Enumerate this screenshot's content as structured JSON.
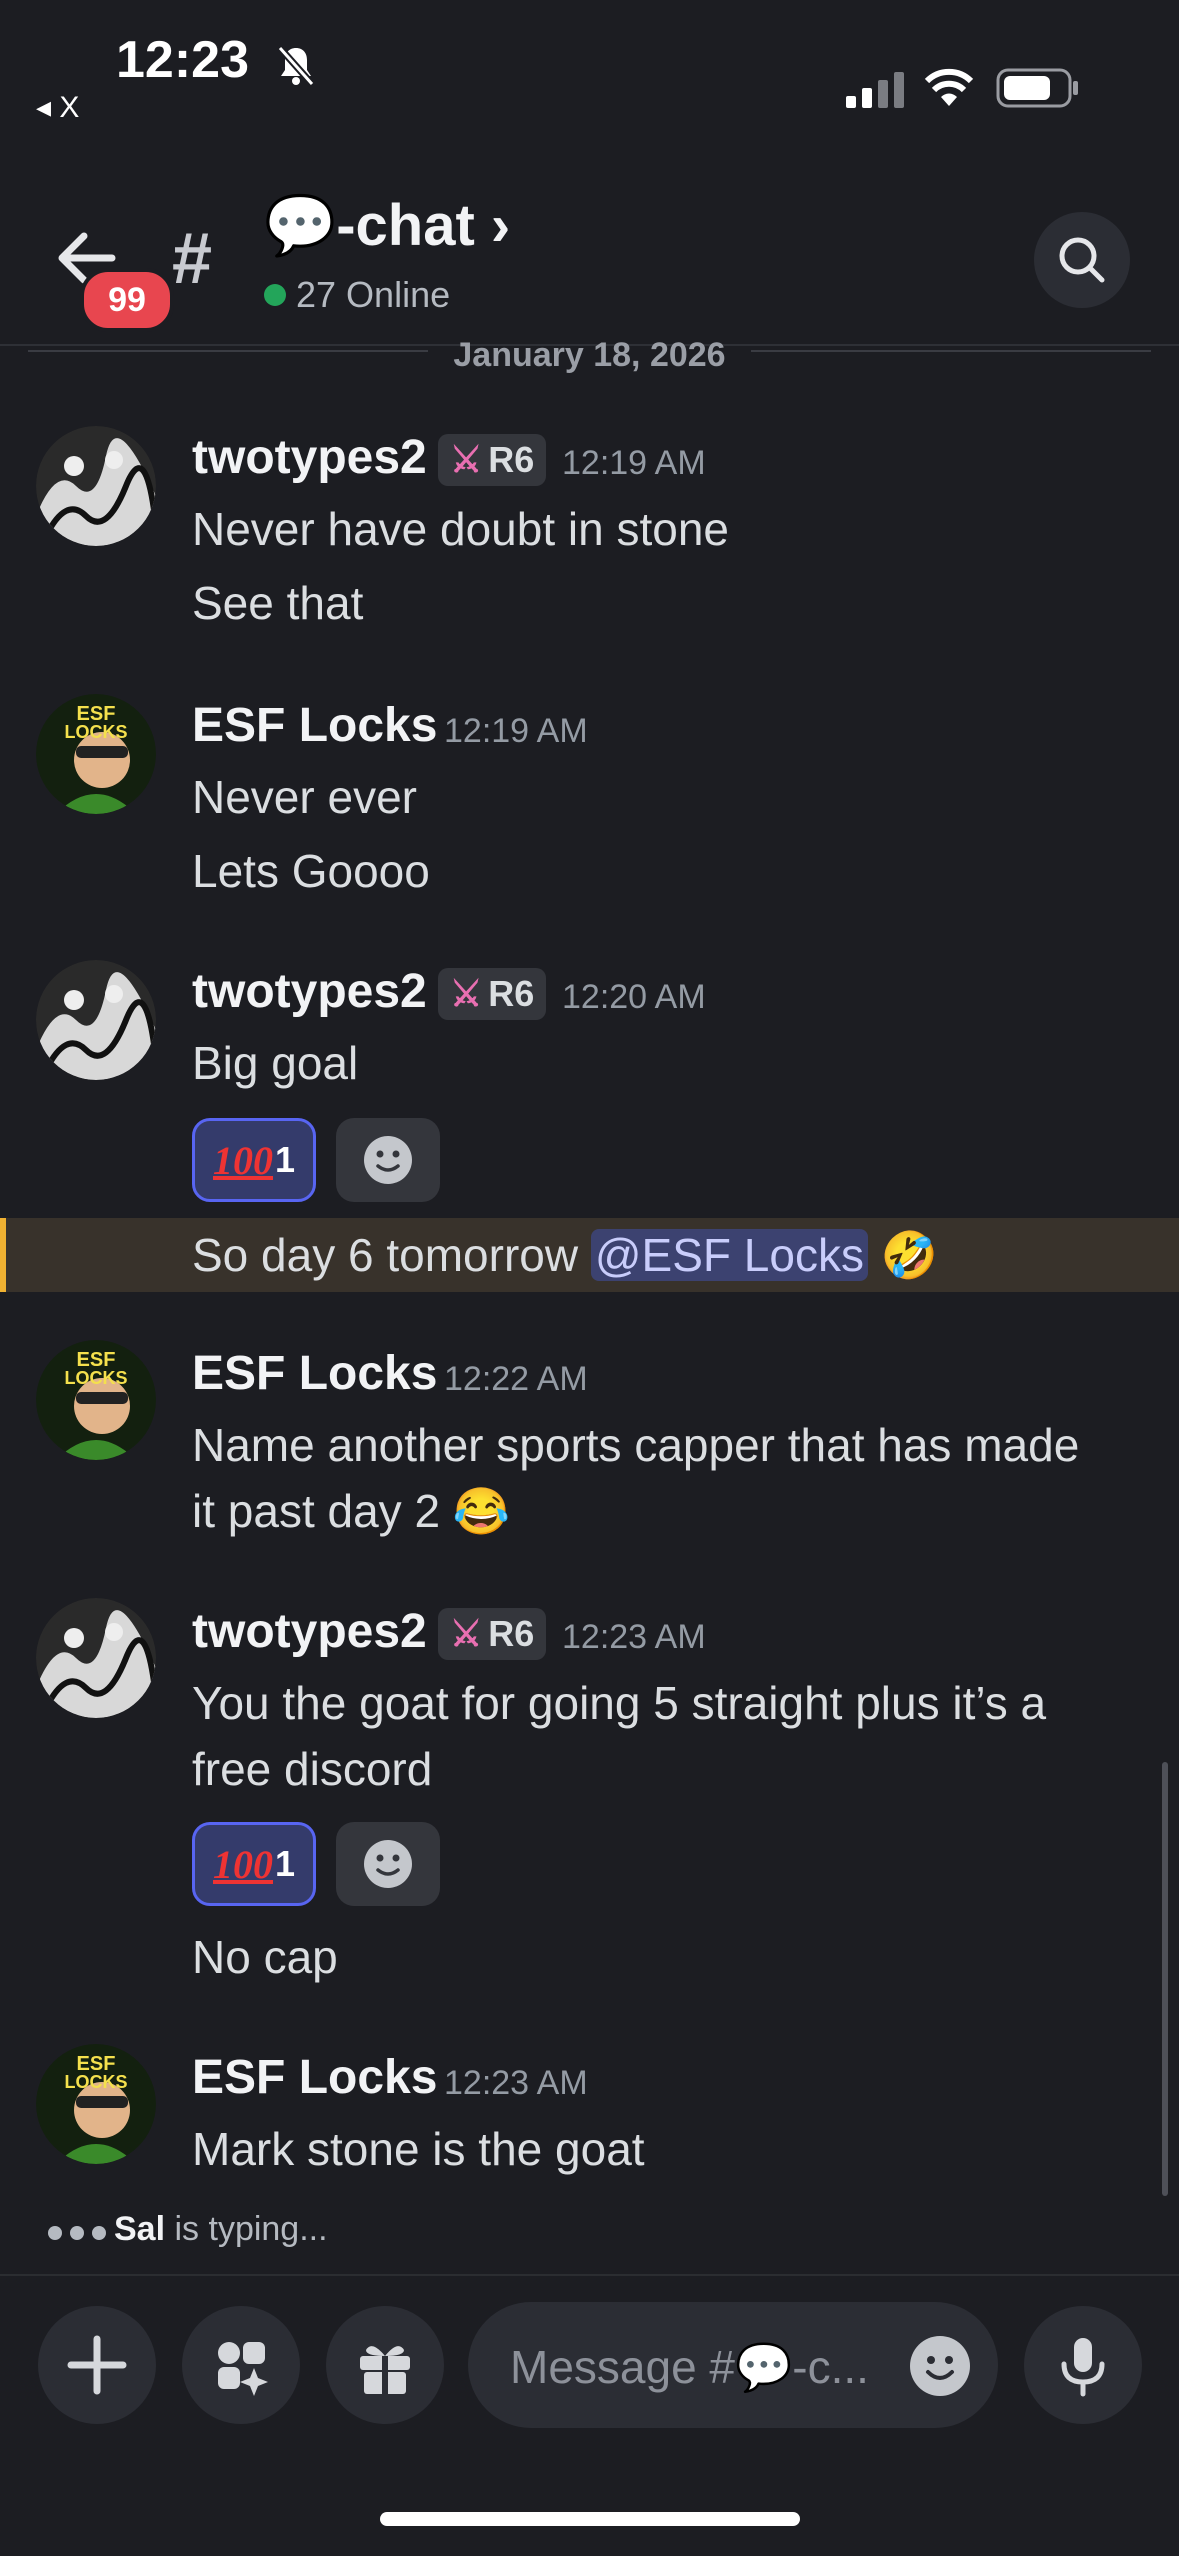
{
  "status_bar": {
    "time": "12:23",
    "back_app": "◂ X",
    "bell_muted": "bell-slash-icon"
  },
  "header": {
    "unread_badge": "99",
    "channel_prefix": "#",
    "channel_name": "💬-chat ›",
    "online": "27 Online"
  },
  "date_divider": "January 18, 2026",
  "messages": [
    {
      "author": "twotypes2",
      "role": "R6",
      "time": "12:19 AM",
      "lines": [
        "Never have doubt in stone",
        "See that"
      ]
    },
    {
      "author": "ESF Locks",
      "time": "12:19 AM",
      "lines": [
        "Never ever",
        "Lets Goooo"
      ]
    },
    {
      "author": "twotypes2",
      "role": "R6",
      "time": "12:20 AM",
      "lines": [
        "Big goal"
      ],
      "reaction": {
        "emoji": "100",
        "count": "1"
      },
      "after": "So day 6 tomorrow ",
      "mention": "@ESF Locks",
      "after_emoji": "🤣"
    },
    {
      "author": "ESF Locks",
      "time": "12:22 AM",
      "lines": [
        "Name another sports capper that has made",
        "it past day 2 😂"
      ]
    },
    {
      "author": "twotypes2",
      "role": "R6",
      "time": "12:23 AM",
      "lines": [
        "You the goat for going 5 straight plus it’s a",
        "free discord"
      ],
      "reaction": {
        "emoji": "100",
        "count": "1"
      },
      "after": "No cap"
    },
    {
      "author": "ESF Locks",
      "time": "12:23 AM",
      "lines": [
        "Mark stone is the goat"
      ]
    }
  ],
  "typing": {
    "user": "Sal",
    "text": " is typing..."
  },
  "composer": {
    "placeholder": "Message #💬-c..."
  },
  "colors": {
    "background": "#1c1d22",
    "accent": "#5865f2",
    "online": "#23a55a",
    "badge": "#e8464f",
    "mention_highlight": "#f0b232"
  }
}
